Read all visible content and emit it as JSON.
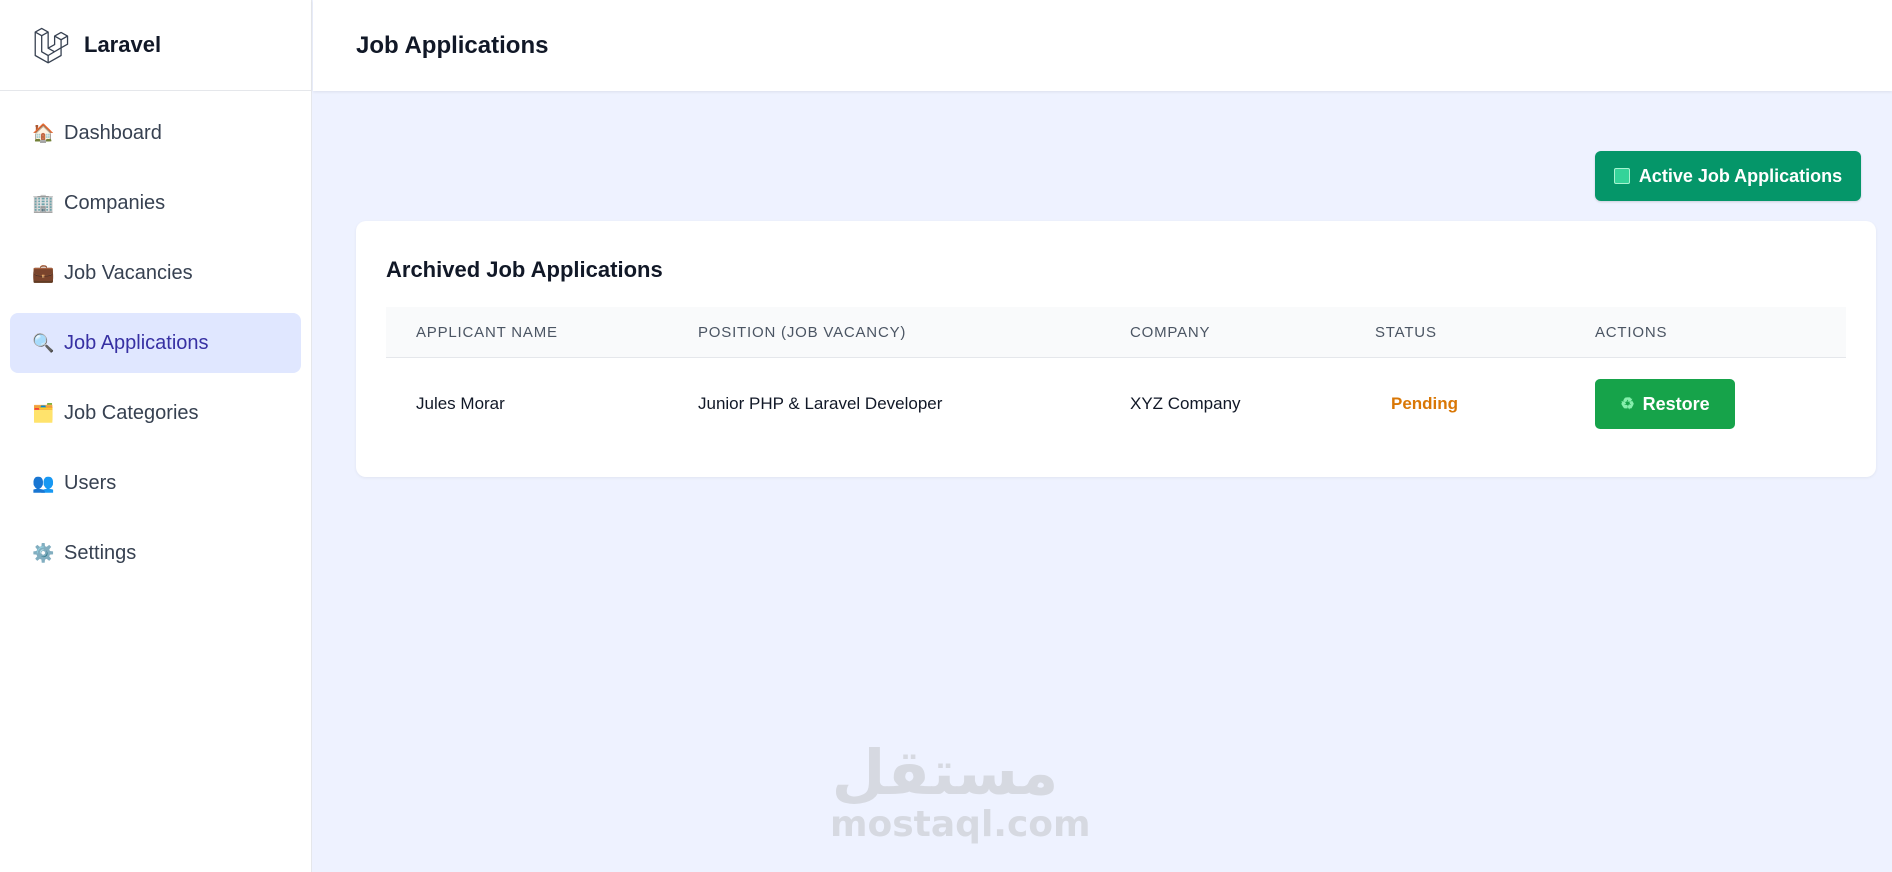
{
  "brand": {
    "name": "Laravel",
    "logo_icon": "laravel-logo-icon"
  },
  "sidebar": {
    "items": [
      {
        "icon": "🏠",
        "icon_name": "house-icon",
        "label": "Dashboard",
        "active": false
      },
      {
        "icon": "🏢",
        "icon_name": "building-icon",
        "label": "Companies",
        "active": false
      },
      {
        "icon": "💼",
        "icon_name": "briefcase-icon",
        "label": "Job Vacancies",
        "active": false
      },
      {
        "icon": "🔍",
        "icon_name": "magnifier-icon",
        "label": "Job Applications",
        "active": true
      },
      {
        "icon": "🗂️",
        "icon_name": "folder-icon",
        "label": "Job Categories",
        "active": false
      },
      {
        "icon": "👥",
        "icon_name": "users-icon",
        "label": "Users",
        "active": false
      },
      {
        "icon": "⚙️",
        "icon_name": "gear-icon",
        "label": "Settings",
        "active": false
      }
    ]
  },
  "header": {
    "title": "Job Applications"
  },
  "toolbar": {
    "active_button_label": "Active Job Applications"
  },
  "card": {
    "title": "Archived Job Applications",
    "columns": [
      "APPLICANT NAME",
      "POSITION (JOB VACANCY)",
      "COMPANY",
      "STATUS",
      "ACTIONS"
    ],
    "rows": [
      {
        "applicant": "Jules Morar",
        "position": "Junior PHP & Laravel Developer",
        "company": "XYZ Company",
        "status": "Pending",
        "action_label": "Restore",
        "action_icon": "♻"
      }
    ]
  },
  "watermark": {
    "arabic": "مستقل",
    "latin": "mostaql.com"
  },
  "colors": {
    "accent": "#3730a3",
    "active_bg": "#e0e7ff",
    "primary_button": "#059669",
    "restore_button": "#16a34a",
    "status_pending": "#d97706",
    "page_bg": "#eef2ff"
  }
}
